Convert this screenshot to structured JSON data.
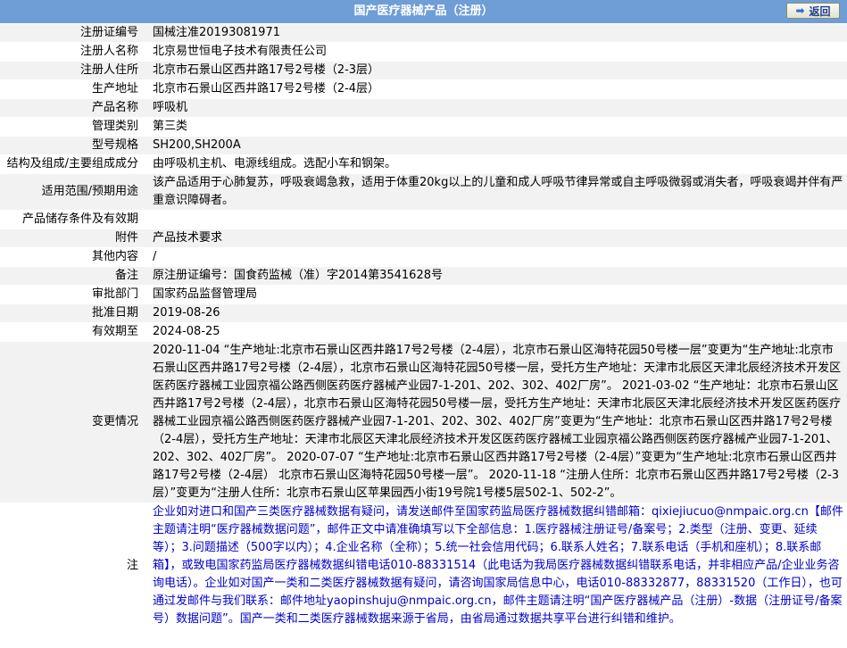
{
  "header": {
    "title": "国产医疗器械产品（注册）",
    "back_label": "返回"
  },
  "rows": [
    {
      "label": "注册证编号",
      "value": "国械注准20193081971"
    },
    {
      "label": "注册人名称",
      "value": "北京易世恒电子技术有限责任公司"
    },
    {
      "label": "注册人住所",
      "value": "北京市石景山区西井路17号2号楼（2-3层）"
    },
    {
      "label": "生产地址",
      "value": "北京市石景山区西井路17号2号楼（2-4层）"
    },
    {
      "label": "产品名称",
      "value": "呼吸机"
    },
    {
      "label": "管理类别",
      "value": "第三类"
    },
    {
      "label": "型号规格",
      "value": "SH200,SH200A"
    },
    {
      "label": "结构及组成/主要组成成分",
      "value": "由呼吸机主机、电源线组成。选配小车和钢架。"
    },
    {
      "label": "适用范围/预期用途",
      "value": "该产品适用于心肺复苏，呼吸衰竭急救，适用于体重20kg以上的儿童和成人呼吸节律异常或自主呼吸微弱或消失者，呼吸衰竭并伴有严重意识障碍者。"
    },
    {
      "label": "产品储存条件及有效期",
      "value": ""
    },
    {
      "label": "附件",
      "value": "产品技术要求"
    },
    {
      "label": "其他内容",
      "value": "/"
    },
    {
      "label": "备注",
      "value": "原注册证编号：国食药监械（准）字2014第3541628号"
    },
    {
      "label": "审批部门",
      "value": "国家药品监督管理局"
    },
    {
      "label": "批准日期",
      "value": "2019-08-26"
    },
    {
      "label": "有效期至",
      "value": "2024-08-25"
    },
    {
      "label": "变更情况",
      "value": "2020-11-04 “生产地址:北京市石景山区西井路17号2号楼（2-4层），北京市石景山区海特花园50号楼一层”变更为“生产地址:北京市石景山区西井路17号2号楼（2-4层），北京市石景山区海特花园50号楼一层，受托方生产地址：天津市北辰区天津北辰经济技术开发区医药医疗器械工业园京福公路西侧医药医疗器械产业园7-1-201、202、302、402厂房”。 2021-03-02 “生产地址：北京市石景山区西井路17号2号楼（2-4层），北京市石景山区海特花园50号楼一层，受托方生产地址：天津市北辰区天津北辰经济技术开发区医药医疗器械工业园京福公路西侧医药医疗器械产业园7-1-201、202、302、402厂房”变更为“生产地址：北京市石景山区西井路17号2号楼（2-4层），受托方生产地址：天津市北辰区天津北辰经济技术开发区医药医疗器械工业园京福公路西侧医药医疗器械产业园7-1-201、202、302、402厂房”。 2020-07-07 “生产地址:北京市石景山区西井路17号2号楼（2-4层）”变更为“生产地址:北京市石景山区西井路17号2号楼（2-4层） 北京市石景山区海特花园50号楼一层”。 2020-11-18 “注册人住所：北京市石景山区西井路17号2号楼（2-3层）”变更为“注册人住所：北京市石景山区苹果园西小街19号院1号楼5层502-1、502-2”。"
    },
    {
      "label": "注",
      "value": "企业如对进口和国产三类医疗器械数据有疑问，请发送邮件至国家药监局医疗器械数据纠错邮箱：qixiejiucuo@nmpaic.org.cn【邮件主题请注明“医疗器械数据问题”，邮件正文中请准确填写以下全部信息：1.医疗器械注册证号/备案号；2.类型（注册、变更、延续等）；3.问题描述（500字以内）；4.企业名称（全称）；5.统一社会信用代码；6.联系人姓名；7.联系电话（手机和座机）；8.联系邮箱】，或致电国家药监局医疗器械数据纠错电话010-88331514（此电话为我局医疗器械数据纠错联系电话，并非相应产品/企业业务咨询电话）。企业如对国产一类和二类医疗器械数据有疑问，请咨询国家局信息中心，电话010-88332877，88331520（工作日），也可通过发邮件与我们联系：邮件地址yaopinshuju@nmpaic.org.cn，邮件主题请注明“国产医疗器械产品（注册）-数据（注册证号/备案号）数据问题”。国产一类和二类医疗器械数据来源于省局，由省局通过数据共享平台进行纠错和维护。"
    }
  ]
}
